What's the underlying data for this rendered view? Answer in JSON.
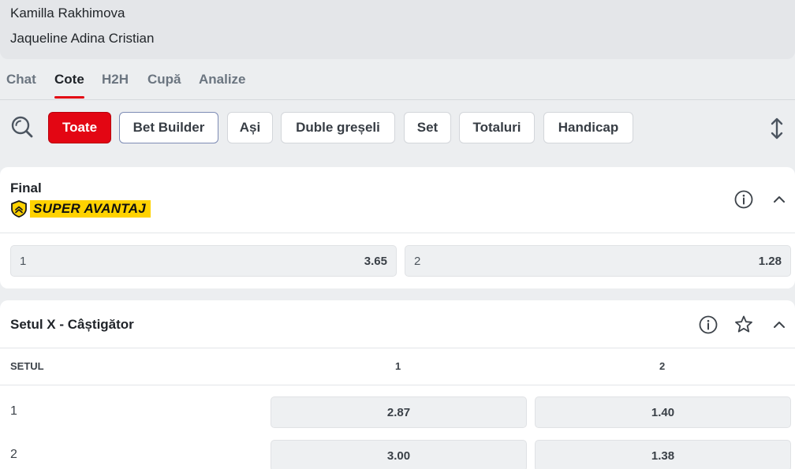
{
  "players": {
    "home": "Kamilla Rakhimova",
    "away": "Jaqueline Adina Cristian"
  },
  "tabs": [
    {
      "label": "Chat",
      "active": false
    },
    {
      "label": "Cote",
      "active": true
    },
    {
      "label": "H2H",
      "active": false
    },
    {
      "label": "Cupă",
      "active": false
    },
    {
      "label": "Analize",
      "active": false
    }
  ],
  "filters": {
    "search_icon": "search-icon",
    "chips": [
      "Toate",
      "Bet Builder",
      "Ași",
      "Duble greșeli",
      "Set",
      "Totaluri",
      "Handicap"
    ],
    "active_chip": "Toate",
    "sort_icon": "expand-vertical-icon"
  },
  "markets": {
    "final": {
      "title": "Final",
      "badge": "SUPER AVANTAJ",
      "badge_icon": "shield-chevrons-icon",
      "info_icon": "info-icon",
      "collapse_icon": "chevron-up-icon",
      "odds": [
        {
          "label": "1",
          "value": "3.65"
        },
        {
          "label": "2",
          "value": "1.28"
        }
      ]
    },
    "set_winner": {
      "title": "Setul X - Câștigător",
      "info_icon": "info-icon",
      "favorite_icon": "star-icon",
      "collapse_icon": "chevron-up-icon",
      "columns": [
        "SETUL",
        "1",
        "2"
      ],
      "rows": [
        {
          "set": "1",
          "odds": [
            "2.87",
            "1.40"
          ]
        },
        {
          "set": "2",
          "odds": [
            "3.00",
            "1.38"
          ]
        }
      ]
    }
  },
  "colors": {
    "accent": "#e30613",
    "badge": "#ffd200"
  }
}
